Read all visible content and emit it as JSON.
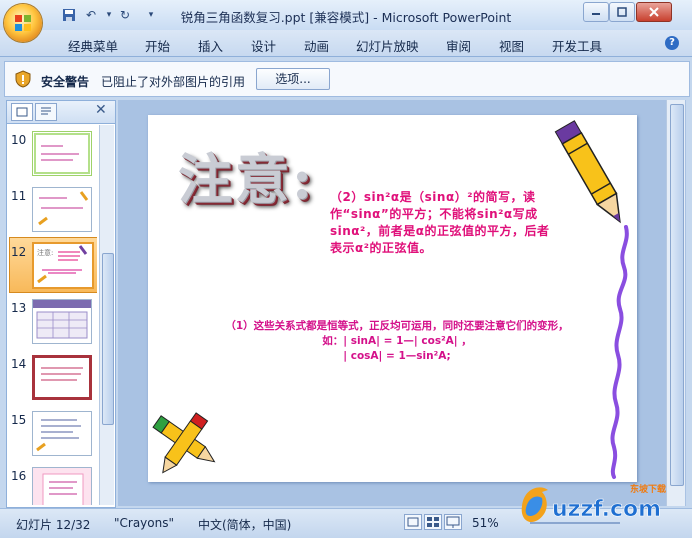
{
  "window": {
    "title": "锐角三角函数复习.ppt [兼容模式] - Microsoft PowerPoint"
  },
  "ribbon": {
    "tabs": [
      "经典菜单",
      "开始",
      "插入",
      "设计",
      "动画",
      "幻灯片放映",
      "审阅",
      "视图",
      "开发工具"
    ]
  },
  "security_bar": {
    "title": "安全警告",
    "message": "已阻止了对外部图片的引用",
    "options_button": "选项..."
  },
  "thumbnails": [
    {
      "number": "10",
      "selected": false
    },
    {
      "number": "11",
      "selected": false
    },
    {
      "number": "12",
      "selected": true
    },
    {
      "number": "13",
      "selected": false
    },
    {
      "number": "14",
      "selected": false
    },
    {
      "number": "15",
      "selected": false
    },
    {
      "number": "16",
      "selected": false
    }
  ],
  "slide": {
    "title": "注意:",
    "text1": "（2）sin²α是（sinα）²的简写，读作“sinα”的平方；不能将sin²α写成sinα²，前者是α的正弦值的平方，后者表示α²的正弦值。",
    "text2_line1": "（1）这些关系式都是恒等式，正反均可运用，同时还要注意它们的变形，",
    "text2_line2": "如：| sinA| = 1—| cos²A| ，",
    "text2_line3": "| cosA| = 1—sin²A;"
  },
  "status_bar": {
    "slide_info": "幻灯片 12/32",
    "theme": "\"Crayons\"",
    "language": "中文(简体，中国)",
    "zoom": "51%"
  },
  "watermark": {
    "text": "uzzf.com",
    "tagline": "东坡下载"
  },
  "colors": {
    "accent_pink": "#e0107a",
    "selected_orange": "#f8b95a",
    "ribbon_blue": "#c7d9f0"
  }
}
